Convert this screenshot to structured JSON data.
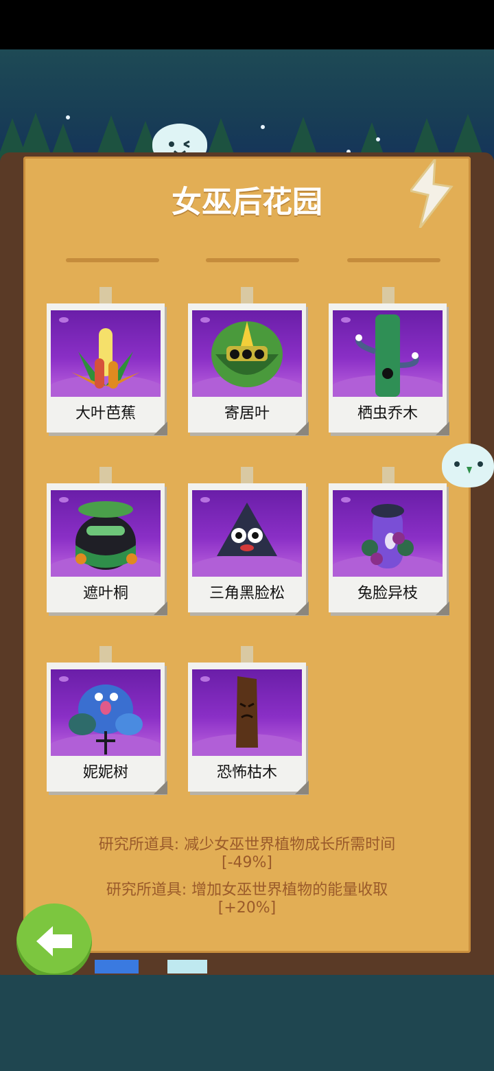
{
  "title": "女巫后花园",
  "plants": [
    {
      "name": "大叶芭蕉"
    },
    {
      "name": "寄居叶"
    },
    {
      "name": "栖虫乔木"
    },
    {
      "name": "遮叶桐"
    },
    {
      "name": "三角黑脸松"
    },
    {
      "name": "兔脸异枝"
    },
    {
      "name": "妮妮树"
    },
    {
      "name": "恐怖枯木"
    }
  ],
  "research": [
    {
      "label": "研究所道具: 减少女巫世界植物成长所需时间",
      "value": "[-49%]"
    },
    {
      "label": "研究所道具: 增加女巫世界植物的能量收取",
      "value": "[+20%]"
    }
  ],
  "icons": {
    "back": "arrow-left-icon",
    "corner": "lightning-bolt-icon"
  },
  "colors": {
    "board": "#e2ae55",
    "frame": "#5a3a26",
    "card_bg": "#8a2fc6",
    "accent_green": "#7cc63f",
    "research_text": "#9a5a2a"
  }
}
